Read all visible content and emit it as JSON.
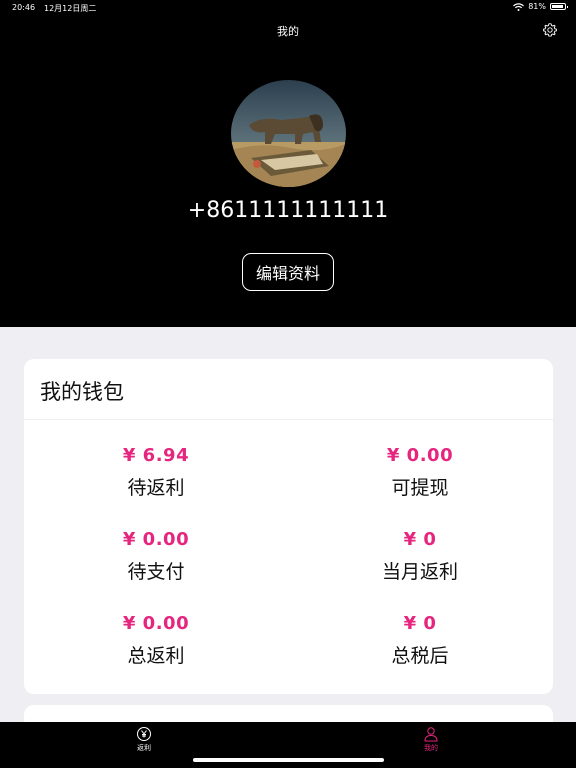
{
  "status_bar": {
    "time": "20:46",
    "date": "12月12日周二",
    "battery": "81%"
  },
  "nav": {
    "title": "我的",
    "settings_icon": "gear-icon"
  },
  "profile": {
    "phone": "+8611111111111",
    "edit_label": "编辑资料"
  },
  "wallet": {
    "title": "我的钱包",
    "items": [
      {
        "value": "¥ 6.94",
        "label": "待返利"
      },
      {
        "value": "¥ 0.00",
        "label": "可提现"
      },
      {
        "value": "¥ 0.00",
        "label": "待支付"
      },
      {
        "value": "¥ 0",
        "label": "当月返利"
      },
      {
        "value": "¥ 0.00",
        "label": "总返利"
      },
      {
        "value": "¥ 0",
        "label": "总税后"
      }
    ]
  },
  "tabs": [
    {
      "label": "返利",
      "icon": "yen-refresh-icon",
      "color": "#ffffff"
    },
    {
      "label": "我的",
      "icon": "person-icon",
      "color": "#e6257f"
    }
  ],
  "colors": {
    "accent": "#e6257f",
    "header_bg": "#000000",
    "page_bg": "#efeef3"
  }
}
